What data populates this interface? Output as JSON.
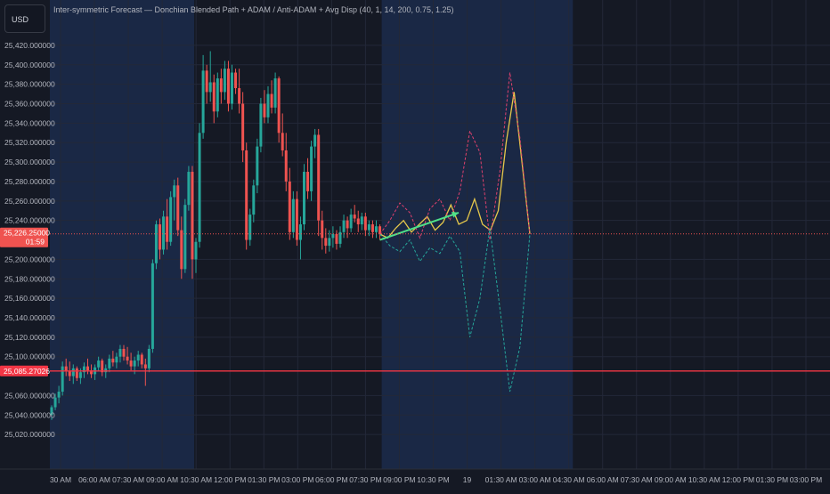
{
  "header": {
    "currency_button": "USD",
    "indicator_title": "Inter-symmetric Forecast — Donchian Blended Path + ADAM / Anti-ADAM + Avg Disp (40, 1, 14, 200, 0.75, 1.25)"
  },
  "price_labels": {
    "last_price": "25,226.25000",
    "countdown": "01:59",
    "level_price": "25,085.27026"
  },
  "colors": {
    "background": "#151924",
    "session_band": "#1a2845",
    "grid": "#232838",
    "up_candle": "#26a69a",
    "down_candle": "#ef5350",
    "blended_path": "#e6c84b",
    "adam": "#e0416d",
    "anti_adam": "#26a69a",
    "trend_arrow": "#4fe089",
    "last_price_line": "#ef5350",
    "level_line": "#f23645"
  },
  "chart_data": {
    "type": "candlestick",
    "title": "",
    "xlabel": "",
    "ylabel": "",
    "ylim": [
      25000,
      25430
    ],
    "x_axis_ticks": [
      "30 AM",
      "06:00 AM",
      "07:30 AM",
      "09:00 AM",
      "10:30 AM",
      "12:00 PM",
      "01:30 PM",
      "03:00 PM",
      "06:00 PM",
      "07:30 PM",
      "09:00 PM",
      "10:30 PM",
      "19",
      "01:30 AM",
      "03:00 AM",
      "04:30 AM",
      "06:00 AM",
      "07:30 AM",
      "09:00 AM",
      "10:30 AM",
      "12:00 PM",
      "01:30 PM",
      "03:00 PM"
    ],
    "y_axis_ticks": [
      "25,420.000000",
      "25,400.000000",
      "25,380.000000",
      "25,360.000000",
      "25,340.000000",
      "25,320.000000",
      "25,300.000000",
      "25,280.000000",
      "25,260.000000",
      "25,240.000000",
      "25,200.000000",
      "25,180.000000",
      "25,160.000000",
      "25,140.000000",
      "25,120.000000",
      "25,100.000000",
      "25,060.000000",
      "25,040.000000",
      "25,020.000000"
    ],
    "y_axis_tick_values": [
      25420,
      25400,
      25380,
      25360,
      25340,
      25320,
      25300,
      25280,
      25260,
      25240,
      25200,
      25180,
      25160,
      25140,
      25120,
      25100,
      25060,
      25040,
      25020
    ],
    "grid": true,
    "last_price": 25226.25,
    "level": 25085.27,
    "session_band_bars": [
      [
        0,
        40
      ],
      [
        92,
        145
      ]
    ],
    "candles": [
      [
        25040,
        25050,
        25035,
        25048
      ],
      [
        25048,
        25062,
        25045,
        25058
      ],
      [
        25058,
        25070,
        25052,
        25064
      ],
      [
        25064,
        25095,
        25060,
        25090
      ],
      [
        25090,
        25098,
        25080,
        25085
      ],
      [
        25085,
        25095,
        25075,
        25080
      ],
      [
        25080,
        25092,
        25072,
        25088
      ],
      [
        25088,
        25090,
        25075,
        25078
      ],
      [
        25078,
        25088,
        25072,
        25084
      ],
      [
        25084,
        25094,
        25078,
        25090
      ],
      [
        25090,
        25098,
        25082,
        25086
      ],
      [
        25086,
        25092,
        25078,
        25082
      ],
      [
        25082,
        25092,
        25076,
        25089
      ],
      [
        25089,
        25100,
        25085,
        25096
      ],
      [
        25096,
        25098,
        25080,
        25084
      ],
      [
        25084,
        25092,
        25078,
        25088
      ],
      [
        25088,
        25102,
        25084,
        25098
      ],
      [
        25098,
        25106,
        25090,
        25094
      ],
      [
        25094,
        25104,
        25088,
        25100
      ],
      [
        25100,
        25112,
        25094,
        25108
      ],
      [
        25108,
        25112,
        25096,
        25100
      ],
      [
        25100,
        25110,
        25092,
        25096
      ],
      [
        25096,
        25104,
        25086,
        25090
      ],
      [
        25090,
        25100,
        25082,
        25096
      ],
      [
        25096,
        25106,
        25090,
        25102
      ],
      [
        25102,
        25104,
        25088,
        25092
      ],
      [
        25092,
        25098,
        25070,
        25088
      ],
      [
        25088,
        25112,
        25084,
        25108
      ],
      [
        25108,
        25200,
        25104,
        25196
      ],
      [
        25196,
        25240,
        25190,
        25236
      ],
      [
        25236,
        25242,
        25200,
        25210
      ],
      [
        25210,
        25250,
        25205,
        25244
      ],
      [
        25244,
        25262,
        25210,
        25218
      ],
      [
        25218,
        25270,
        25214,
        25264
      ],
      [
        25264,
        25282,
        25240,
        25276
      ],
      [
        25276,
        25284,
        25224,
        25230
      ],
      [
        25230,
        25244,
        25180,
        25190
      ],
      [
        25190,
        25262,
        25186,
        25256
      ],
      [
        25256,
        25296,
        25250,
        25290
      ],
      [
        25290,
        25296,
        25180,
        25200
      ],
      [
        25200,
        25222,
        25186,
        25218
      ],
      [
        25218,
        25340,
        25212,
        25330
      ],
      [
        25330,
        25410,
        25324,
        25394
      ],
      [
        25394,
        25400,
        25360,
        25372
      ],
      [
        25372,
        25414,
        25362,
        25382
      ],
      [
        25382,
        25390,
        25340,
        25352
      ],
      [
        25352,
        25392,
        25346,
        25386
      ],
      [
        25386,
        25396,
        25360,
        25372
      ],
      [
        25372,
        25404,
        25364,
        25396
      ],
      [
        25396,
        25404,
        25352,
        25360
      ],
      [
        25360,
        25400,
        25354,
        25392
      ],
      [
        25392,
        25396,
        25370,
        25376
      ],
      [
        25376,
        25396,
        25350,
        25360
      ],
      [
        25360,
        25372,
        25300,
        25312
      ],
      [
        25312,
        25320,
        25210,
        25220
      ],
      [
        25220,
        25252,
        25214,
        25246
      ],
      [
        25246,
        25282,
        25238,
        25276
      ],
      [
        25276,
        25324,
        25268,
        25316
      ],
      [
        25316,
        25366,
        25310,
        25360
      ],
      [
        25360,
        25374,
        25340,
        25346
      ],
      [
        25346,
        25378,
        25340,
        25370
      ],
      [
        25370,
        25384,
        25350,
        25356
      ],
      [
        25356,
        25392,
        25350,
        25386
      ],
      [
        25386,
        25388,
        25320,
        25330
      ],
      [
        25330,
        25350,
        25306,
        25312
      ],
      [
        25312,
        25330,
        25270,
        25280
      ],
      [
        25280,
        25294,
        25220,
        25228
      ],
      [
        25228,
        25270,
        25222,
        25262
      ],
      [
        25262,
        25270,
        25214,
        25220
      ],
      [
        25220,
        25244,
        25200,
        25236
      ],
      [
        25236,
        25298,
        25230,
        25290
      ],
      [
        25290,
        25304,
        25262,
        25270
      ],
      [
        25270,
        25322,
        25260,
        25316
      ],
      [
        25316,
        25334,
        25304,
        25328
      ],
      [
        25328,
        25334,
        25224,
        25240
      ],
      [
        25240,
        25250,
        25210,
        25222
      ],
      [
        25222,
        25232,
        25206,
        25214
      ],
      [
        25214,
        25230,
        25208,
        25222
      ],
      [
        25222,
        25234,
        25212,
        25226
      ],
      [
        25226,
        25230,
        25210,
        25216
      ],
      [
        25216,
        25234,
        25212,
        25228
      ],
      [
        25228,
        25246,
        25222,
        25240
      ],
      [
        25240,
        25244,
        25222,
        25232
      ],
      [
        25232,
        25252,
        25228,
        25246
      ],
      [
        25246,
        25256,
        25238,
        25242
      ],
      [
        25242,
        25250,
        25228,
        25236
      ],
      [
        25236,
        25248,
        25230,
        25244
      ],
      [
        25244,
        25248,
        25224,
        25230
      ],
      [
        25230,
        25240,
        25224,
        25236
      ],
      [
        25236,
        25240,
        25222,
        25228
      ],
      [
        25228,
        25240,
        25222,
        25234
      ],
      [
        25234,
        25236,
        25220,
        25226
      ]
    ],
    "forecast_series": [
      {
        "key": "blended_path",
        "values": [
          25226,
          25222,
          25232,
          25240,
          25228,
          25236,
          25244,
          25230,
          25238,
          25256,
          25236,
          25240,
          25262,
          25236,
          25230,
          25250,
          25320,
          25372,
          25300,
          25226
        ]
      },
      {
        "key": "adam",
        "values": [
          25226,
          25240,
          25258,
          25248,
          25222,
          25252,
          25262,
          25240,
          25270,
          25332,
          25310,
          25220,
          25290,
          25392,
          25325,
          25226
        ]
      },
      {
        "key": "anti_adam",
        "values": [
          25226,
          25214,
          25208,
          25220,
          25198,
          25212,
          25206,
          25224,
          25208,
          25120,
          25160,
          25232,
          25150,
          25064,
          25110,
          25226
        ]
      }
    ],
    "trend_arrow": [
      [
        25220,
        25248
      ]
    ]
  }
}
